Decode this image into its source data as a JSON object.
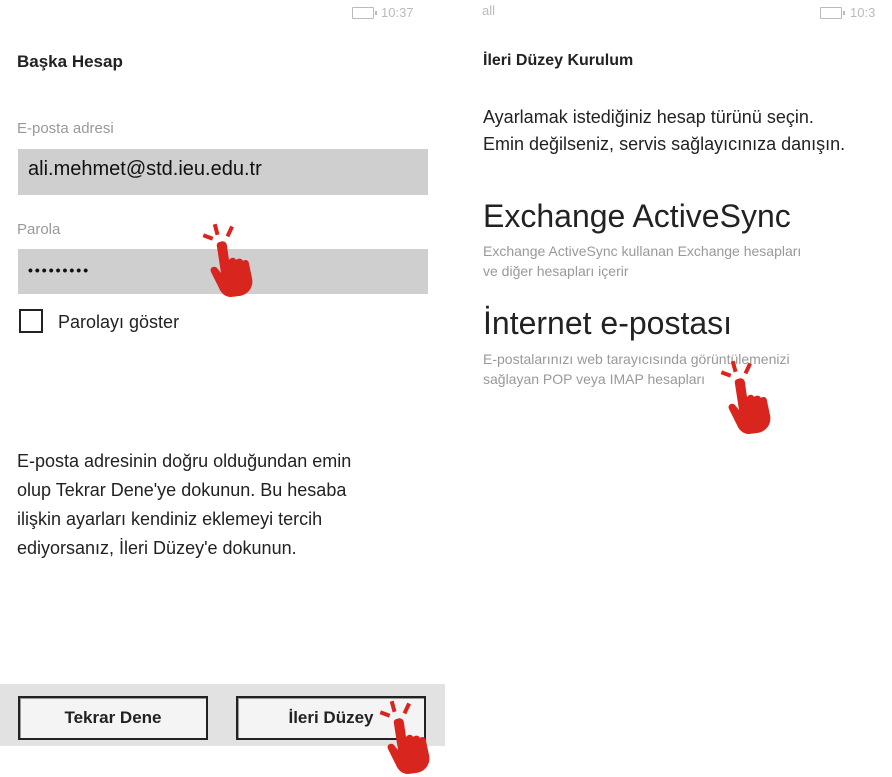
{
  "left_screen": {
    "status_bar": {
      "time": "10:37",
      "battery_icon": "battery-icon"
    },
    "title": "Başka Hesap",
    "email_label": "E-posta adresi",
    "email_value": "ali.mehmet@std.ieu.edu.tr",
    "password_label": "Parola",
    "password_mask": "•••••••••",
    "show_password_label": "Parolayı göster",
    "show_password_checked": false,
    "info_lines": [
      "E-posta adresinin doğru olduğundan emin",
      "olup Tekrar Dene'ye dokunun. Bu hesaba",
      "ilişkin ayarları kendiniz eklemeyi tercih",
      "ediyorsanız, İleri Düzey'e dokunun."
    ],
    "buttons": {
      "retry": "Tekrar Dene",
      "advanced": "İleri Düzey"
    }
  },
  "right_screen": {
    "status_bar": {
      "signal": "all",
      "time": "10:3",
      "battery_icon": "battery-icon"
    },
    "title": "İleri Düzey Kurulum",
    "intro_lines": [
      "Ayarlamak istediğiniz hesap türünü seçin.",
      "Emin değilseniz, servis sağlayıcınıza danışın."
    ],
    "options": [
      {
        "title": "Exchange ActiveSync",
        "desc_lines": [
          "Exchange ActiveSync kullanan Exchange hesapları",
          "ve diğer hesapları içerir"
        ]
      },
      {
        "title": "İnternet e-postası",
        "desc_lines": [
          "E-postalarınızı web tarayıcısında görüntülemenizi",
          "sağlayan POP veya IMAP hesapları"
        ]
      }
    ]
  },
  "annotations": {
    "icon": "tap-hand-icon",
    "color": "#d8261f"
  }
}
